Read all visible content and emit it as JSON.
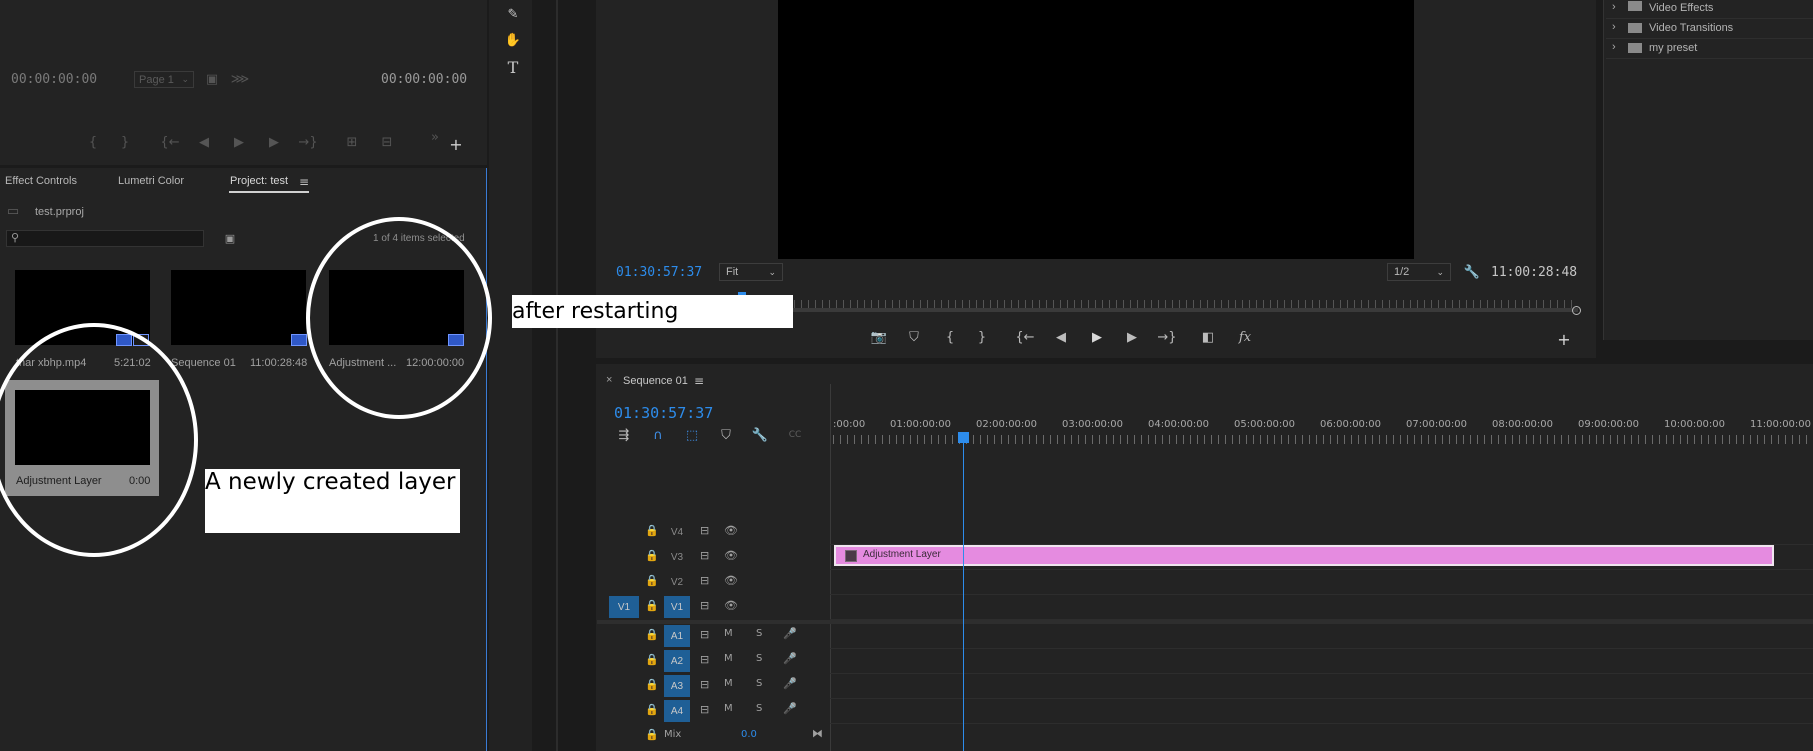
{
  "source_monitor": {
    "timecode_left": "00:00:00:00",
    "page_select": "Page 1",
    "timecode_right": "00:00:00:00"
  },
  "project_panel": {
    "tabs": [
      "Effect Controls",
      "Lumetri Color",
      "Project: test"
    ],
    "menu_icon": "hamburger-icon",
    "filename": "test.prproj",
    "search_placeholder": "",
    "selection_status": "1 of 4 items selected",
    "items": [
      {
        "name": "thar xbhp.mp4",
        "duration": "5:21:02"
      },
      {
        "name": "Sequence 01",
        "duration": "11:00:28:48"
      },
      {
        "name": "Adjustment ...",
        "duration": "12:00:00:00"
      },
      {
        "name": "Adjustment Layer",
        "duration": "0:00"
      }
    ]
  },
  "program_monitor": {
    "timecode": "01:30:57:37",
    "zoom": "Fit",
    "resolution": "1/2",
    "duration": "11:00:28:48"
  },
  "effects_panel": {
    "folders": [
      "Video Effects",
      "Video Transitions",
      "my preset"
    ]
  },
  "timeline": {
    "sequence_name": "Sequence 01",
    "close_icon": "×",
    "timecode": "01:30:57:37",
    "ruler_labels": [
      ":00:00",
      "01:00:00:00",
      "02:00:00:00",
      "03:00:00:00",
      "04:00:00:00",
      "05:00:00:00",
      "06:00:00:00",
      "07:00:00:00",
      "08:00:00:00",
      "09:00:00:00",
      "10:00:00:00",
      "11:00:00:00"
    ],
    "video_tracks": [
      "V4",
      "V3",
      "V2",
      "V1"
    ],
    "source_patch": "V1",
    "audio_tracks": [
      "A1",
      "A2",
      "A3",
      "A4"
    ],
    "audio_buttons": {
      "mute": "M",
      "solo": "S"
    },
    "mix_label": "Mix",
    "mix_value": "0.0",
    "clip_label": "Adjustment Layer",
    "clip_color": "#e58be0"
  },
  "annotations": {
    "after_restarting": "after restarting",
    "newly_created": "A newly created layer"
  },
  "colors": {
    "accent_blue": "#2d8ceb",
    "track_on": "#1f5f96",
    "panel": "#232323"
  }
}
